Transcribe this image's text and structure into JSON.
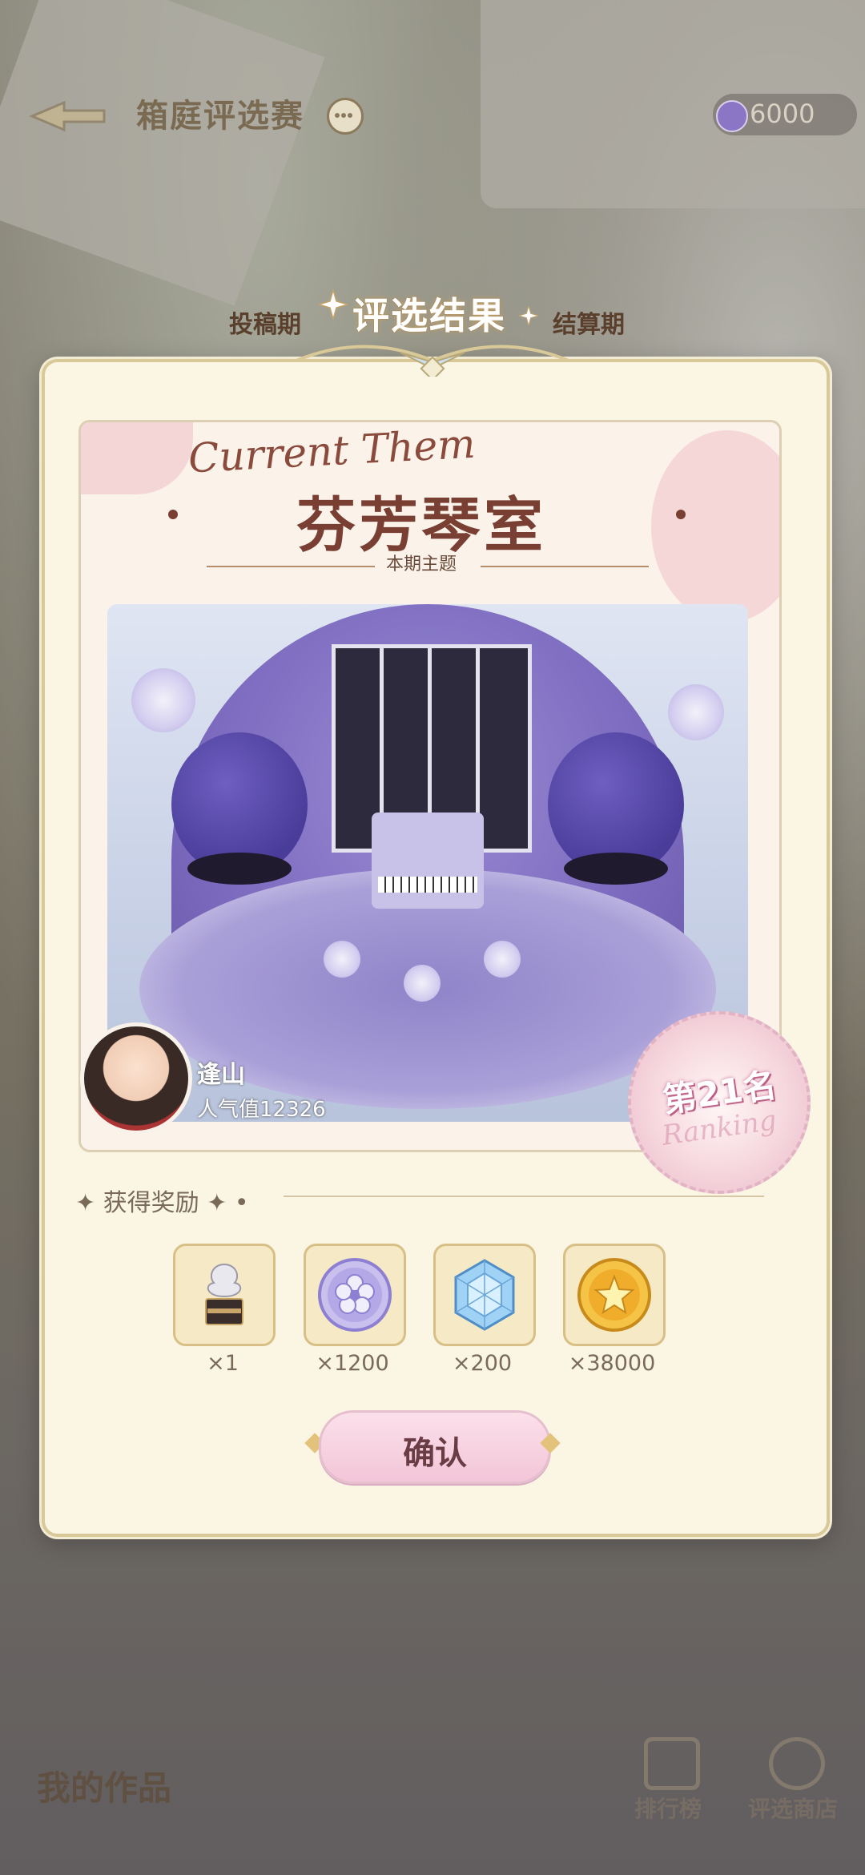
{
  "header": {
    "title": "箱庭评选赛",
    "currency_amount": "6000"
  },
  "phases": {
    "left": "投稿期",
    "right": "结算期",
    "result_title": "评选结果"
  },
  "theme": {
    "script_title": "Current Them",
    "name": "芬芳琴室",
    "subtitle": "本期主题"
  },
  "entry": {
    "author": "逢山",
    "popularity": "人气值12326",
    "rank": "第21名",
    "rank_script": "Ranking"
  },
  "rewards": {
    "title": "获得奖励",
    "items": [
      {
        "icon": "rose-box-icon",
        "qty": "×1"
      },
      {
        "icon": "purple-flower-coin-icon",
        "qty": "×1200"
      },
      {
        "icon": "blue-crystal-icon",
        "qty": "×200"
      },
      {
        "icon": "gold-star-coin-icon",
        "qty": "×38000"
      }
    ]
  },
  "confirm_label": "确认",
  "bottom": {
    "my_works": "我的作品",
    "leaderboard": "排行榜",
    "shop": "评选商店"
  },
  "colors": {
    "accent_pink": "#f3c6d8",
    "modal_bg": "#fbf6e4",
    "title_brown": "#7a3f33"
  }
}
